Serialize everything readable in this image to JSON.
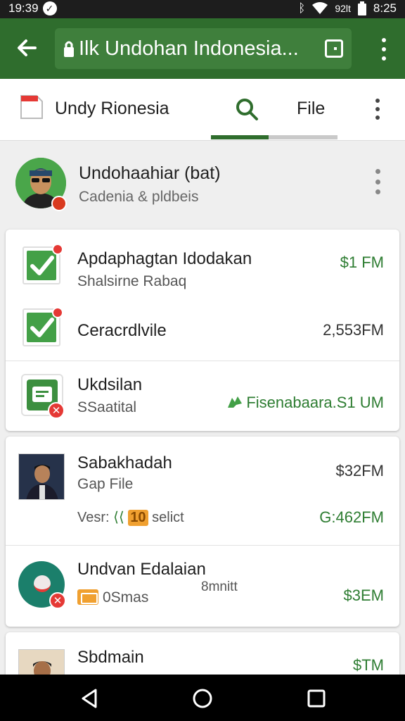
{
  "status_bar": {
    "time_left": "19:39",
    "network": "92lt",
    "time_right": "8:25"
  },
  "app_bar": {
    "url": "Ilk Undohan Indonesia..."
  },
  "tabs": {
    "title": "Undy Rionesia",
    "file_label": "File"
  },
  "profile": {
    "name": "Undohaahiar (bat)",
    "subtitle": "Cadenia & pldbeis"
  },
  "card1": {
    "rows": [
      {
        "title": "Apdaphagtan Idodakan",
        "subtitle": "Shalsirne Rabaq",
        "amount": "$1 FM"
      },
      {
        "title": "Ceracrdlvile",
        "amount": "2,553FM"
      },
      {
        "title": "Ukdsilan",
        "subtitle": "SSaatital",
        "amount": "Fisenabaara.S1 UM"
      }
    ]
  },
  "card2": {
    "rows": [
      {
        "title": "Sabakhadah",
        "subtitle": "Gap File",
        "amount": "$32FM",
        "extra_prefix": "Vesr:",
        "extra_badge": "10",
        "extra_suffix": "selict",
        "extra_amount": "G:462FM"
      },
      {
        "title": "Undvan Edalaian",
        "subtitle": "0Smas",
        "note": "8mnitt",
        "amount": "$3EM"
      }
    ]
  },
  "card3": {
    "title": "Sbdmain",
    "amount": "$TM"
  },
  "colors": {
    "app_bar": "#2f6d2d",
    "accent_green": "#2e7d32",
    "alert_red": "#e53935"
  }
}
